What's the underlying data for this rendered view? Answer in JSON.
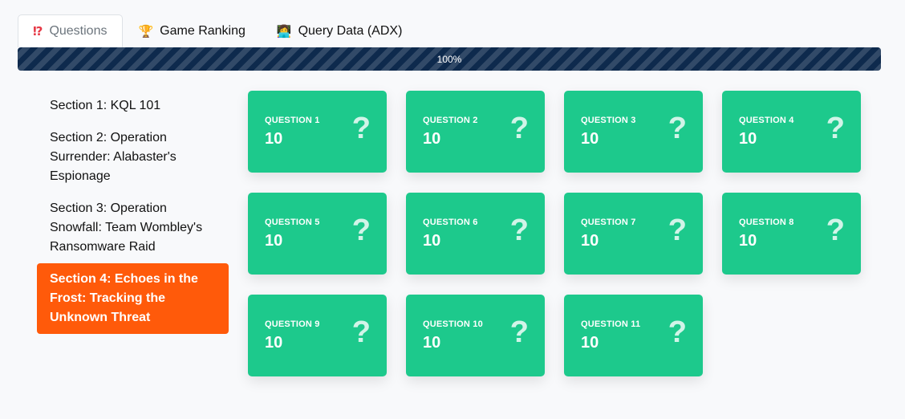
{
  "tabs": [
    {
      "icon": "⁉",
      "label": "Questions",
      "active": true
    },
    {
      "icon": "🏆",
      "label": "Game Ranking",
      "active": false
    },
    {
      "icon": "👩‍💻",
      "label": "Query Data (ADX)",
      "active": false
    }
  ],
  "progress": {
    "value": 1.0,
    "label": "100%"
  },
  "sections": [
    {
      "label": "Section 1: KQL 101",
      "active": false
    },
    {
      "label": "Section 2: Operation Surrender: Alabaster's Espionage",
      "active": false
    },
    {
      "label": "Section 3: Operation Snowfall: Team Wombley's Ransomware Raid",
      "active": false
    },
    {
      "label": "Section 4: Echoes in the Frost: Tracking the Unknown Threat",
      "active": true
    }
  ],
  "questions": [
    {
      "label": "QUESTION 1",
      "points": "10",
      "icon": "?"
    },
    {
      "label": "QUESTION 2",
      "points": "10",
      "icon": "?"
    },
    {
      "label": "QUESTION 3",
      "points": "10",
      "icon": "?"
    },
    {
      "label": "QUESTION 4",
      "points": "10",
      "icon": "?"
    },
    {
      "label": "QUESTION 5",
      "points": "10",
      "icon": "?"
    },
    {
      "label": "QUESTION 6",
      "points": "10",
      "icon": "?"
    },
    {
      "label": "QUESTION 7",
      "points": "10",
      "icon": "?"
    },
    {
      "label": "QUESTION 8",
      "points": "10",
      "icon": "?"
    },
    {
      "label": "QUESTION 9",
      "points": "10",
      "icon": "?"
    },
    {
      "label": "QUESTION 10",
      "points": "10",
      "icon": "?"
    },
    {
      "label": "QUESTION 11",
      "points": "10",
      "icon": "?"
    }
  ],
  "colors": {
    "accent_active_section": "#ff5a0a",
    "card_green": "#1dc98c",
    "progress_navy": "#0e2a4d"
  }
}
